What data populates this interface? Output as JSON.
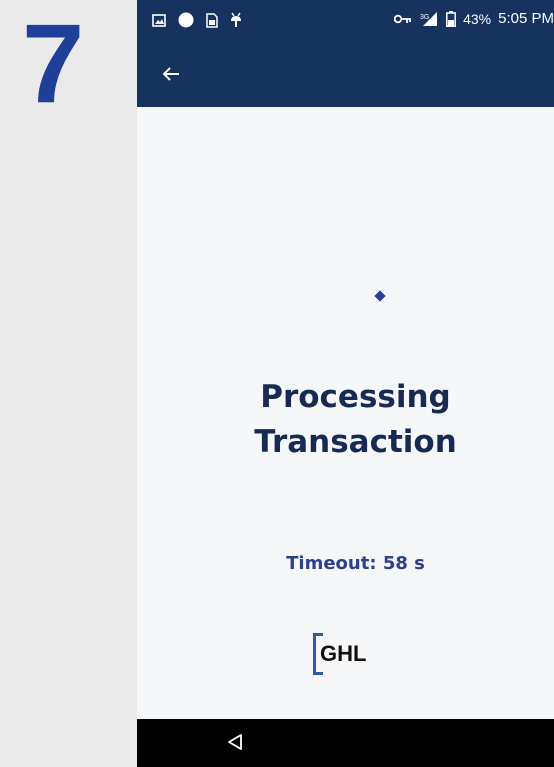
{
  "step": {
    "number": "7"
  },
  "status_bar": {
    "battery_percent": "43%",
    "time": "5:05 PM",
    "network": "3G",
    "icons": [
      "image-icon",
      "circle-icon",
      "sim-toolkit-icon",
      "android-debug-icon",
      "key-icon",
      "signal-icon",
      "battery-icon"
    ]
  },
  "app_bar": {
    "back_icon": "arrow-left-icon"
  },
  "main": {
    "title_line1": "Processing",
    "title_line2": "Transaction",
    "timeout_label": "Timeout:",
    "timeout_value": "58 s"
  },
  "logo": {
    "text": "GHL"
  },
  "nav_bar": {
    "back_icon": "triangle-back-icon"
  },
  "colors": {
    "header": "#16325f",
    "accent": "#2c3f91",
    "title": "#172a55",
    "step_number": "#1e3f9a",
    "background": "#f6f7f9"
  }
}
